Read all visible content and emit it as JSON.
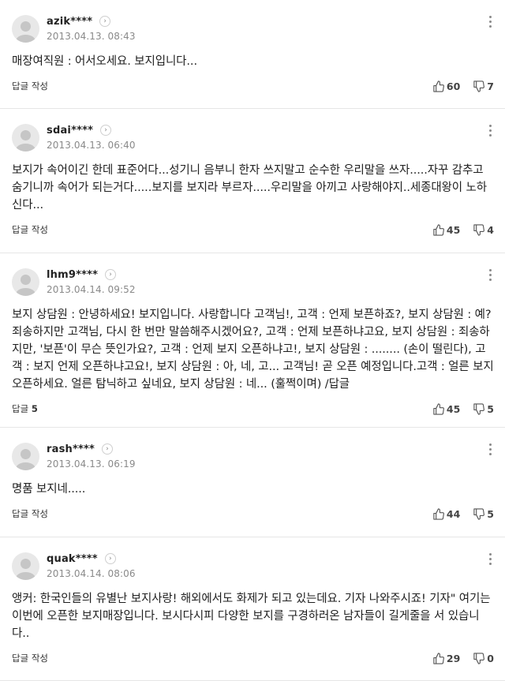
{
  "comments": [
    {
      "username": "azik****",
      "date": "2013.04.13. 08:43",
      "body": "매장여직원 : 어서오세요. 보지입니다...",
      "reply_label": "답글 작성",
      "likes": "60",
      "dislikes": "7"
    },
    {
      "username": "sdai****",
      "date": "2013.04.13. 06:40",
      "body": "보지가 속어이긴 한데 표준어다...성기니 음부니 한자 쓰지말고 순수한 우리말을 쓰자.....자꾸 감추고 숨기니까 속어가 되는거다.....보지를 보지라 부르자.....우리말을 아끼고 사랑해야지..세종대왕이 노하신다...",
      "reply_label": "답글 작성",
      "likes": "45",
      "dislikes": "4"
    },
    {
      "username": "lhm9****",
      "date": "2013.04.14. 09:52",
      "body": "보지 상담원 : 안녕하세요! 보지입니다. 사랑합니다 고객님!, 고객 : 언제 보픈하죠?, 보지 상담원 : 예? 죄송하지만 고객님, 다시 한 번만 말씀해주시겠어요?, 고객 : 언제 보픈하냐고요, 보지 상담원 : 죄송하지만, '보픈'이 무슨 뜻인가요?, 고객 : 언제 보지 오픈하냐고!, 보지 상담원 : ........ (손이 떨린다), 고객 : 보지 언제 오픈하냐고요!, 보지 상담원 : 아, 네, 고... 고객님! 곧 오픈 예정입니다.고객 : 얼른 보지 오픈하세요. 얼른 탐닉하고 싶네요, 보지 상담원 : 네... (훌쩍이며) /답글",
      "reply_label": "답글",
      "reply_count": "5",
      "likes": "45",
      "dislikes": "5"
    },
    {
      "username": "rash****",
      "date": "2013.04.13. 06:19",
      "body": "명품 보지네.....",
      "reply_label": "답글 작성",
      "likes": "44",
      "dislikes": "5"
    },
    {
      "username": "quak****",
      "date": "2013.04.14. 08:06",
      "body": "앵커: 한국인들의 유별난 보지사랑! 해외에서도 화제가 되고 있는데요. 기자 나와주시죠! 기자\" 여기는 이번에 오픈한 보지매장입니다. 보시다시피 다양한 보지를 구경하러온 남자들이 길게줄을 서 있습니다..",
      "reply_label": "답글 작성",
      "likes": "29",
      "dislikes": "0"
    }
  ]
}
